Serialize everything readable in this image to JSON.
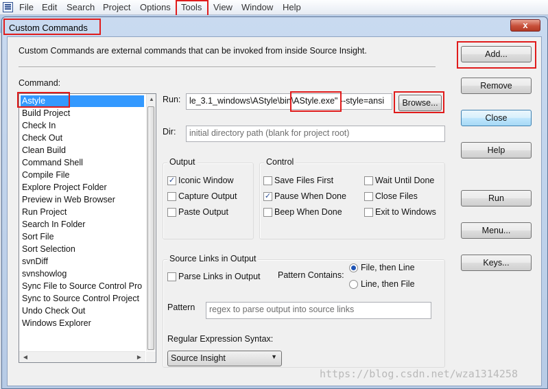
{
  "menubar": {
    "items": [
      "File",
      "Edit",
      "Search",
      "Project",
      "Options",
      "Tools",
      "View",
      "Window",
      "Help"
    ]
  },
  "dialog": {
    "title": "Custom Commands",
    "close_glyph": "x",
    "description": "Custom Commands are external commands that can be invoked from inside Source Insight."
  },
  "commands": {
    "label": "Command:",
    "items": [
      "Astyle",
      "Build Project",
      "Check In",
      "Check Out",
      "Clean Build",
      "Command Shell",
      "Compile File",
      "Explore Project Folder",
      "Preview in Web Browser",
      "Run Project",
      "Search In Folder",
      "Sort File",
      "Sort Selection",
      "svnDiff",
      "svnshowlog",
      "Sync File to Source Control Pro",
      "Sync to Source Control Project",
      "Undo Check Out",
      "Windows Explorer"
    ],
    "selected": "Astyle"
  },
  "run": {
    "label": "Run:",
    "value": "le_3.1_windows\\AStyle\\bin\\AStyle.exe\" --style=ansi",
    "browse_label": "Browse..."
  },
  "dir": {
    "label": "Dir:",
    "placeholder": "initial directory path (blank for project root)"
  },
  "output": {
    "title": "Output",
    "iconic_window": {
      "label": "Iconic Window",
      "checked": true
    },
    "capture_output": {
      "label": "Capture Output",
      "checked": false
    },
    "paste_output": {
      "label": "Paste Output",
      "checked": false
    }
  },
  "control": {
    "title": "Control",
    "save_files_first": {
      "label": "Save Files First",
      "checked": false
    },
    "pause_when_done": {
      "label": "Pause When Done",
      "checked": true
    },
    "beep_when_done": {
      "label": "Beep When Done",
      "checked": false
    },
    "wait_until_done": {
      "label": "Wait Until Done",
      "checked": false
    },
    "close_files": {
      "label": "Close Files",
      "checked": false
    },
    "exit_to_windows": {
      "label": "Exit to Windows",
      "checked": false
    }
  },
  "source_links": {
    "title": "Source Links in Output",
    "parse_links": {
      "label": "Parse Links in Output",
      "checked": false
    },
    "pattern_contains_label": "Pattern Contains:",
    "file_then_line": {
      "label": "File, then Line",
      "selected": true
    },
    "line_then_file": {
      "label": "Line, then File",
      "selected": false
    },
    "pattern_label": "Pattern",
    "pattern_placeholder": "regex to parse output into source links",
    "regex_syntax_label": "Regular Expression Syntax:",
    "regex_syntax_value": "Source Insight"
  },
  "buttons": {
    "add": "Add...",
    "remove": "Remove",
    "close": "Close",
    "help": "Help",
    "run": "Run",
    "menu": "Menu...",
    "keys": "Keys..."
  },
  "check_glyph": "✓",
  "watermark": "https://blog.csdn.net/wza1314258",
  "colors": {
    "selection": "#3399ff",
    "highlight": "#e01b1b"
  }
}
